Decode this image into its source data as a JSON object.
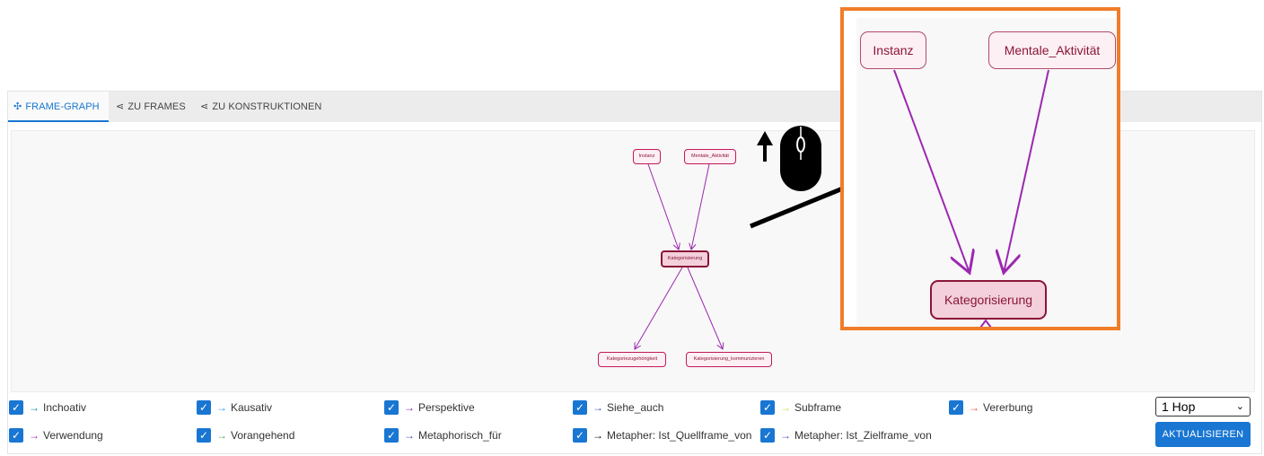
{
  "tabs": [
    {
      "label": "FRAME-GRAPH",
      "icon": "graph-icon",
      "active": true
    },
    {
      "label": "ZU FRAMES",
      "icon": "share-icon",
      "active": false
    },
    {
      "label": "ZU KONSTRUKTIONEN",
      "icon": "share-icon",
      "active": false
    }
  ],
  "graph": {
    "nodes": {
      "instanz": "Instanz",
      "mentale": "Mentale_Aktivität",
      "kategorisierung": "Kategorisierung",
      "zugehoerigkeit": "Kategoriezugehörigkeit",
      "kommunizieren": "Kategorisierung_kommunizieren"
    },
    "edge_color": "#9c27b0"
  },
  "zoom": {
    "instanz": "Instanz",
    "mentale": "Mentale_Aktivität",
    "kategorisierung": "Kategorisierung",
    "frame_color": "#f07d2a"
  },
  "legend": {
    "row1": [
      {
        "label": "Inchoativ",
        "color": "#009688"
      },
      {
        "label": "Kausativ",
        "color": "#2196f3"
      },
      {
        "label": "Perspektive",
        "color": "#7b1fa2"
      },
      {
        "label": "Siehe_auch",
        "color": "#3f51b5"
      },
      {
        "label": "Subframe",
        "color": "#cddc39"
      },
      {
        "label": "Vererbung",
        "color": "#f44336"
      }
    ],
    "row2": [
      {
        "label": "Verwendung",
        "color": "#9c27b0"
      },
      {
        "label": "Vorangehend",
        "color": "#4caf50"
      },
      {
        "label": "Metaphorisch_für",
        "color": "#3f51b5"
      },
      {
        "label": "Metapher: Ist_Quellframe_von",
        "color": "#000000"
      },
      {
        "label": "Metapher: Ist_Zielframe_von",
        "color": "#3f51b5"
      }
    ]
  },
  "controls": {
    "hop_value": "1 Hop",
    "update_label": "AKTUALISIEREN"
  },
  "accent_color": "#1976d2"
}
